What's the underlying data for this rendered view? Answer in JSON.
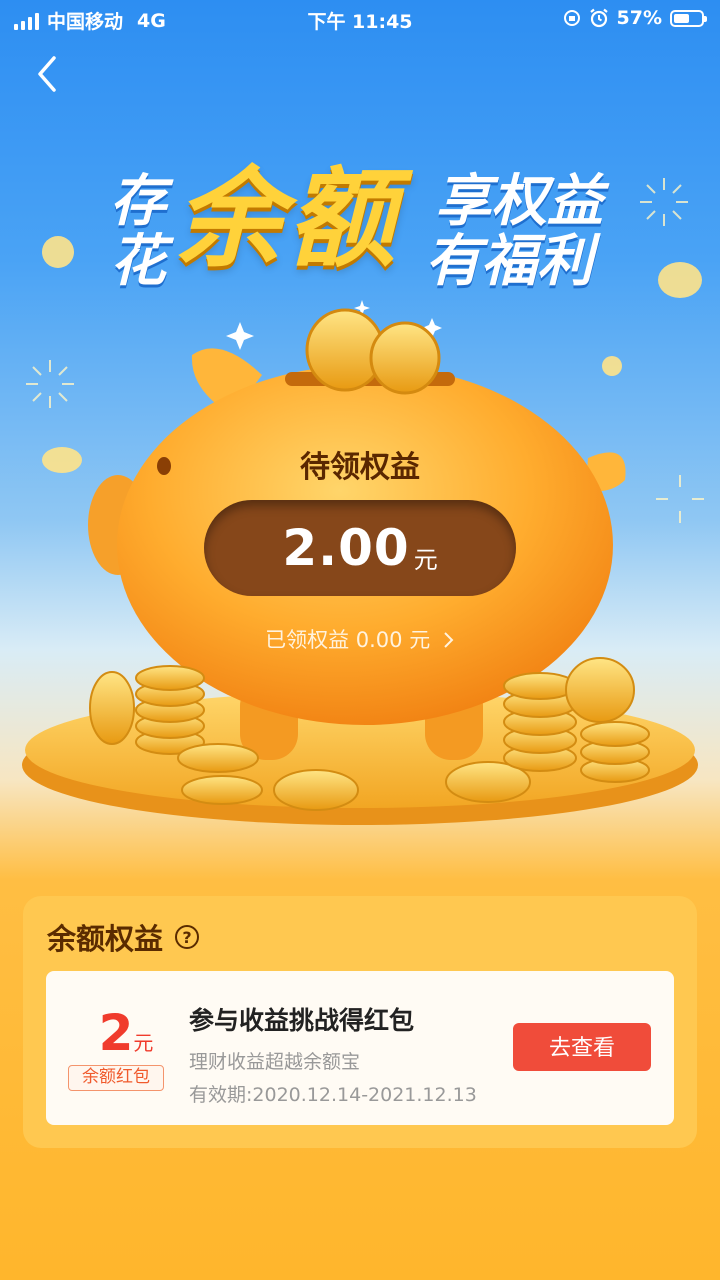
{
  "status_bar": {
    "carrier": "中国移动",
    "network": "4G",
    "time": "下午 11:45",
    "battery_pct": "57%"
  },
  "banner": {
    "left_top": "存",
    "left_bottom": "花",
    "big": "余额",
    "right_top": "享权益",
    "right_bottom": "有福利"
  },
  "pig": {
    "title": "待领权益",
    "amount": "2.00",
    "unit": "元",
    "claimed_text": "已领权益 0.00 元"
  },
  "benefits": {
    "title": "余额权益",
    "card": {
      "value": "2",
      "value_unit": "元",
      "tag": "余额红包",
      "title": "参与收益挑战得红包",
      "subtitle": "理财收益超越余额宝",
      "validity": "有效期:2020.12.14-2021.12.13",
      "button": "去查看"
    }
  },
  "colors": {
    "accent_red": "#f04c3a",
    "gold": "#ffd23a",
    "brown": "#86471a"
  }
}
